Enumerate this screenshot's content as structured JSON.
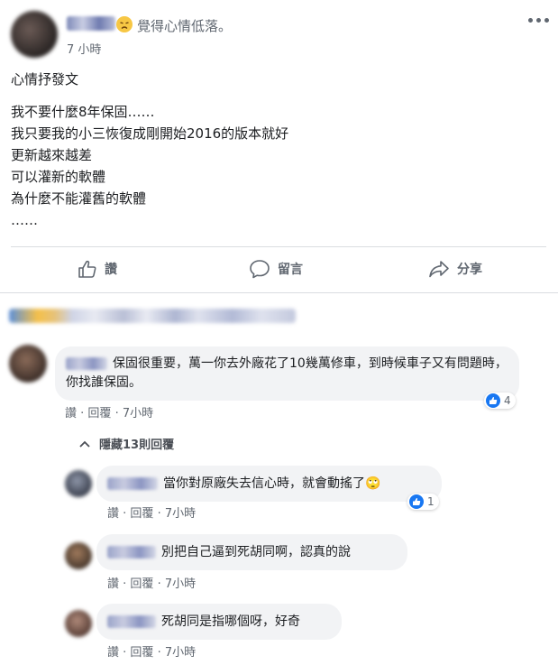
{
  "post": {
    "feeling": "覺得心情低落。",
    "time": "7 小時",
    "more_icon": "ellipsis-icon",
    "lines": [
      "心情抒發文",
      "我不要什麼8年保固……",
      "我只要我的小三恢復成剛開始2016的版本就好",
      "更新越來越差",
      "可以灌新的軟體",
      "為什麼不能灌舊的軟體",
      "……"
    ],
    "actions": {
      "like": "讚",
      "comment": "留言",
      "share": "分享"
    }
  },
  "comments": {
    "main": {
      "text": "保固很重要，萬一你去外廠花了10幾萬修車，到時候車子又有問題時，你找誰保固。",
      "reaction_count": "4",
      "like": "讚",
      "reply": "回覆",
      "time": "7小時"
    },
    "hide_replies": "隱藏13則回覆",
    "replies": [
      {
        "text": "當你對原廠失去信心時，就會動搖了",
        "emoji": "🙄",
        "reaction_count": "1",
        "like": "讚",
        "reply": "回覆",
        "time": "7小時"
      },
      {
        "text": "別把自己逼到死胡同啊，認真的說",
        "like": "讚",
        "reply": "回覆",
        "time": "7小時"
      },
      {
        "text": "死胡同是指哪個呀，好奇",
        "like": "讚",
        "reply": "回覆",
        "time": "7小時"
      }
    ]
  },
  "colors": {
    "accent": "#1877f2",
    "muted": "#606770",
    "bubble": "#f2f3f5"
  }
}
